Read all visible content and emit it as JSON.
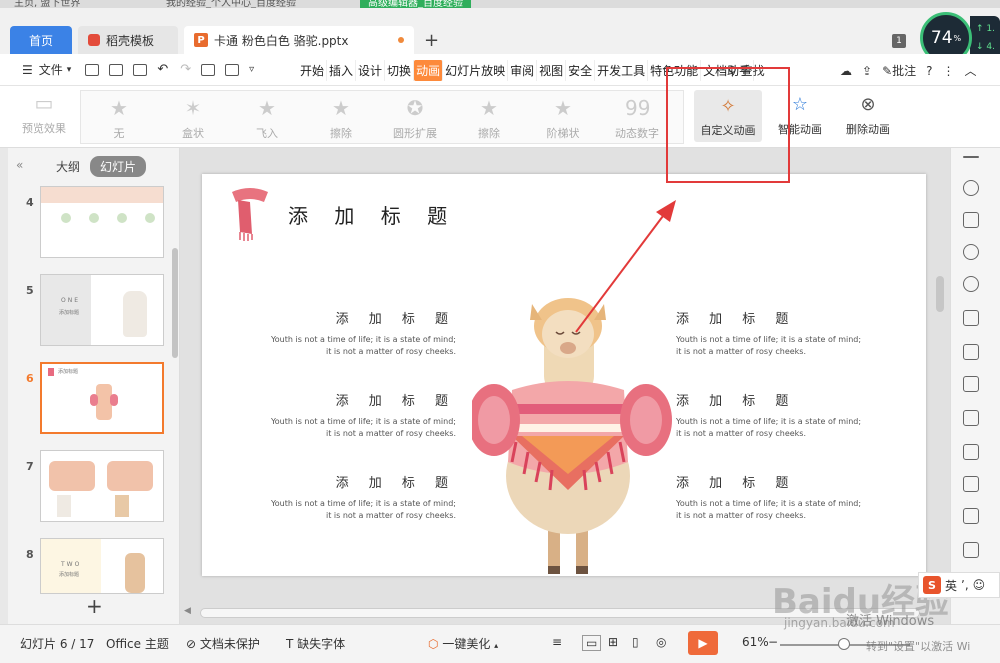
{
  "os_tabs": [
    "主页, 盟下世界",
    "我的经验_个人中心_百度经验",
    "高级编辑器_百度经验"
  ],
  "tabs": {
    "home": "首页",
    "docer": "稻壳模板",
    "doc": "卡通 粉色白色 骆驼.pptx",
    "badge": "1"
  },
  "perf": {
    "value": "74",
    "unit": "%",
    "up": "1.",
    "down": "4."
  },
  "menu": {
    "file": "文件",
    "items": [
      "开始",
      "插入",
      "设计",
      "切换",
      "动画",
      "幻灯片放映",
      "审阅",
      "视图",
      "安全",
      "开发工具",
      "特色功能",
      "文档助手"
    ],
    "active": "动画",
    "search": "查找",
    "comment": "批注"
  },
  "ribbon": {
    "preview": "预览效果",
    "gallery": [
      "无",
      "盒状",
      "飞入",
      "擦除",
      "圆形扩展",
      "擦除",
      "阶梯状",
      "动态数字"
    ],
    "custom": "自定义动画",
    "smart": "智能动画",
    "delete": "删除动画"
  },
  "left_panel": {
    "outline": "大纲",
    "slides": "幻灯片",
    "thumbs": [
      "4",
      "5",
      "6",
      "7",
      "8"
    ],
    "active_thumb": "6",
    "thumb_texts": {
      "5a": "ONE",
      "5b": "添加标题",
      "6": "添加标题",
      "8a": "TWO",
      "8b": "添加标题"
    }
  },
  "slide": {
    "title": "添 加 标 题",
    "blocks": [
      {
        "heading": "添 加 标 题",
        "line1": "Youth is not a time of life; it is a state of mind;",
        "line2": "it is not a matter of rosy cheeks."
      },
      {
        "heading": "添 加 标 题",
        "line1": "Youth is not a time of life; it is a state of mind;",
        "line2": "it is not a matter of rosy cheeks."
      },
      {
        "heading": "添 加 标 题",
        "line1": "Youth is not a time of life; it is a state of mind;",
        "line2": "it is not a matter of rosy cheeks."
      },
      {
        "heading": "添 加 标 题",
        "line1": "Youth is not a time of life; it is a state of mind;",
        "line2": "it is not a matter of rosy cheeks."
      },
      {
        "heading": "添 加 标 题",
        "line1": "Youth is not a time of life; it is a state of mind;",
        "line2": "it is not a matter of rosy cheeks."
      },
      {
        "heading": "添 加 标 题",
        "line1": "Youth is not a time of life; it is a state of mind;",
        "line2": "it is not a matter of rosy cheeks."
      }
    ]
  },
  "status": {
    "slide_count": "幻灯片 6 / 17",
    "theme": "Office 主题",
    "protect": "文档未保护",
    "font": "缺失字体",
    "beautify": "一键美化",
    "zoom": "61%"
  },
  "watermark": {
    "logo": "Baidu经验",
    "url": "jingyan.baidu.com",
    "activate": "激活 Windows",
    "activate_hint": "转到\"设置\"以激活 Wi"
  },
  "ime": {
    "s": "S",
    "lang": "英"
  },
  "colors": {
    "accent": "#fd8a3b",
    "home_tab": "#3b82e6",
    "highlight": "#e23a3a"
  }
}
